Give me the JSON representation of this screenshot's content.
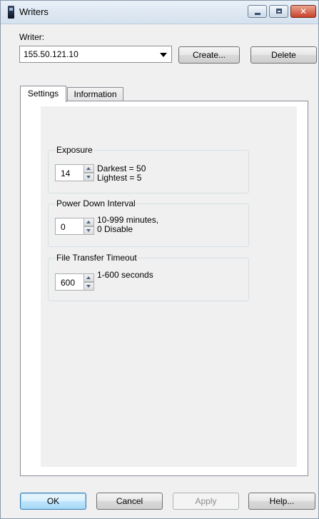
{
  "window": {
    "title": "Writers"
  },
  "writer": {
    "label": "Writer:",
    "selected": "155.50.121.10",
    "create_label": "Create...",
    "delete_label": "Delete"
  },
  "tabs": [
    {
      "label": "Settings",
      "active": true
    },
    {
      "label": "Information",
      "active": false
    }
  ],
  "settings": {
    "exposure": {
      "title": "Exposure",
      "value": "14",
      "hint_line1": "Darkest = 50",
      "hint_line2": "Lightest = 5"
    },
    "power_down": {
      "title": "Power Down Interval",
      "value": "0",
      "hint_line1": "10-999 minutes,",
      "hint_line2": "0 Disable"
    },
    "file_transfer": {
      "title": "File Transfer Timeout",
      "value": "600",
      "hint_line1": "1-600 seconds"
    }
  },
  "footer": {
    "ok_label": "OK",
    "cancel_label": "Cancel",
    "apply_label": "Apply",
    "help_label": "Help..."
  },
  "colors": {
    "titlebar": "#d5e1ee",
    "panel": "#f0f0f0",
    "close_button": "#c8412a",
    "default_button": "#3c7fb1"
  }
}
